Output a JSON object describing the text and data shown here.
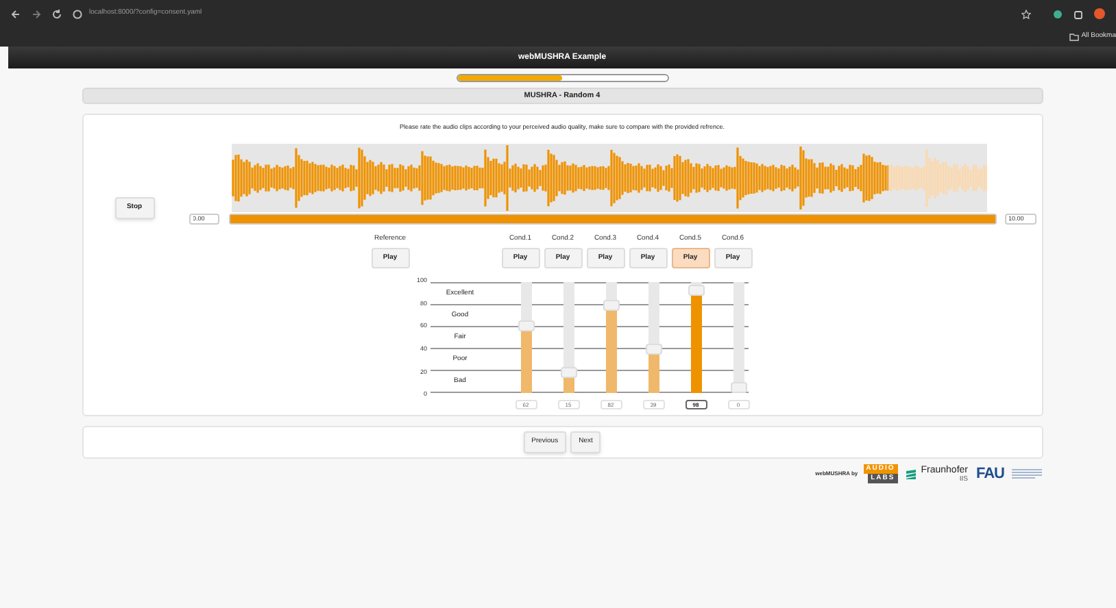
{
  "browser": {
    "url": "localhost:8000/?config=consent.yaml",
    "bookmarks_label": "All Bookma"
  },
  "header": {
    "title": "webMUSHRA Example"
  },
  "progress": {
    "level": 0.5
  },
  "page_title": "MUSHRA - Random 4",
  "instruction": "Please rate the audio clips according to your perceived audio quality, make sure to compare with the provided refrence.",
  "player": {
    "stop_label": "Stop",
    "waveform_played": {
      "level": 0.87
    },
    "start_time": "0.00",
    "end_time": "10.00",
    "position": {
      "level": 1.0
    }
  },
  "reference": {
    "label": "Reference",
    "button": "Play"
  },
  "conditions": [
    {
      "label": "Cond.1",
      "button": "Play",
      "selected": false,
      "level": 0.62,
      "value": "62"
    },
    {
      "label": "Cond.2",
      "button": "Play",
      "selected": false,
      "level": 0.15,
      "value": "15"
    },
    {
      "label": "Cond.3",
      "button": "Play",
      "selected": false,
      "level": 0.82,
      "value": "82"
    },
    {
      "label": "Cond.4",
      "button": "Play",
      "selected": false,
      "level": 0.39,
      "value": "39"
    },
    {
      "label": "Cond.5",
      "button": "Play",
      "selected": true,
      "level": 0.98,
      "value": "98"
    },
    {
      "label": "Cond.6",
      "button": "Play",
      "selected": false,
      "level": 0.0,
      "value": "0"
    }
  ],
  "scale": {
    "ticks": [
      "100",
      "80",
      "60",
      "40",
      "20",
      "0"
    ],
    "labels": [
      "Excellent",
      "Good",
      "Fair",
      "Poor",
      "Bad"
    ]
  },
  "navigation": [
    "Previous",
    "Next"
  ],
  "footer": {
    "credit": "webMUSHRA by",
    "audiolabs_top": "AUDIO",
    "audiolabs_bottom": "LABS",
    "fraunhofer": "Fraunhofer",
    "fraunhofer_sub": "IIS",
    "fau": "FAU"
  }
}
